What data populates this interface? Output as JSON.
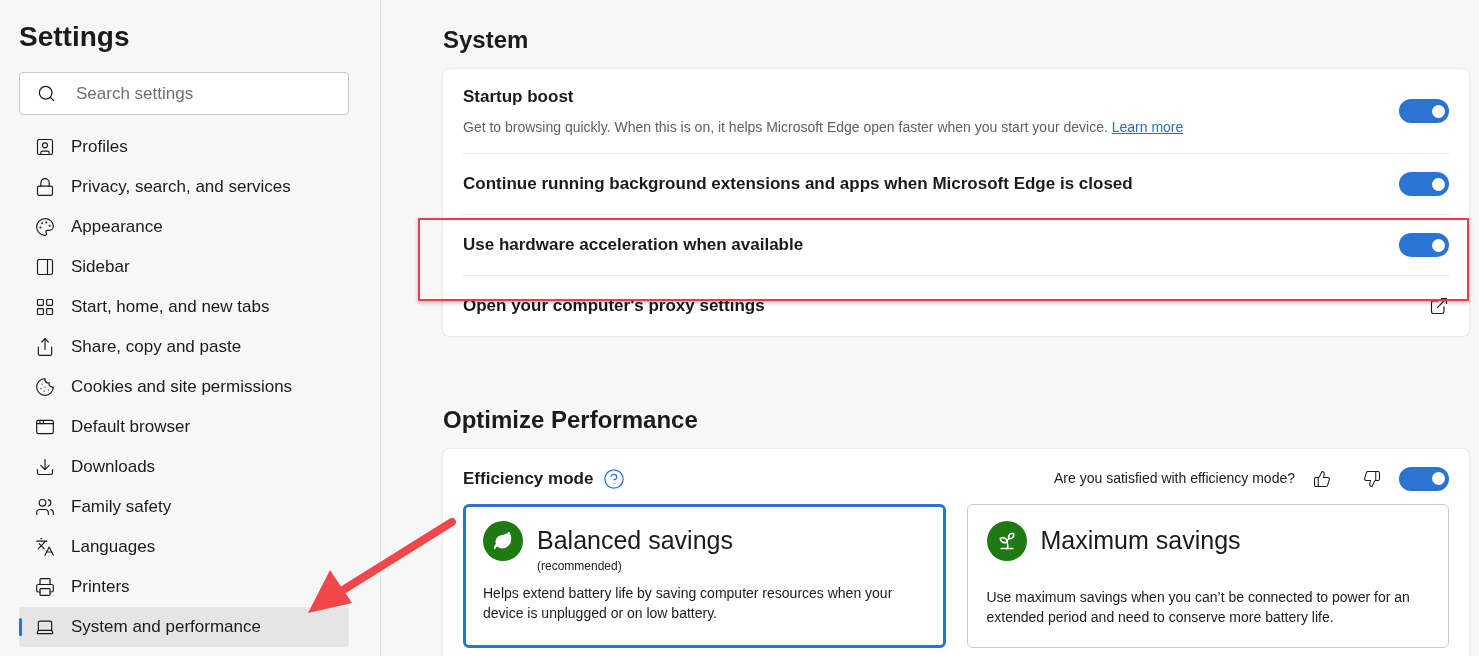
{
  "sidebar": {
    "title": "Settings",
    "search": {
      "placeholder": "Search settings"
    },
    "items": [
      {
        "label": "Profiles",
        "selected": false
      },
      {
        "label": "Privacy, search, and services",
        "selected": false
      },
      {
        "label": "Appearance",
        "selected": false
      },
      {
        "label": "Sidebar",
        "selected": false
      },
      {
        "label": "Start, home, and new tabs",
        "selected": false
      },
      {
        "label": "Share, copy and paste",
        "selected": false
      },
      {
        "label": "Cookies and site permissions",
        "selected": false
      },
      {
        "label": "Default browser",
        "selected": false
      },
      {
        "label": "Downloads",
        "selected": false
      },
      {
        "label": "Family safety",
        "selected": false
      },
      {
        "label": "Languages",
        "selected": false
      },
      {
        "label": "Printers",
        "selected": false
      },
      {
        "label": "System and performance",
        "selected": true
      }
    ]
  },
  "system": {
    "title": "System",
    "rows": [
      {
        "kind": "toggle",
        "label": "Startup boost",
        "description": "Get to browsing quickly. When this is on, it helps Microsoft Edge open faster when you start your device.",
        "link": "Learn more",
        "on": true
      },
      {
        "kind": "toggle",
        "label": "Continue running background extensions and apps when Microsoft Edge is closed",
        "on": true
      },
      {
        "kind": "toggle",
        "label": "Use hardware acceleration when available",
        "on": true
      },
      {
        "kind": "external",
        "label": "Open your computer's proxy settings"
      }
    ]
  },
  "performance": {
    "title": "Optimize Performance",
    "efficiency": {
      "label": "Efficiency mode",
      "feedback": "Are you satisfied with efficiency mode?",
      "on": true
    },
    "cards": [
      {
        "title": "Balanced savings",
        "subtitle": "(recommended)",
        "description": "Helps extend battery life by saving computer resources when your device is unplugged or on low battery.",
        "selected": true
      },
      {
        "title": "Maximum savings",
        "description": "Use maximum savings when you can’t be connected to power for an extended period and need to conserve more battery life.",
        "selected": false
      }
    ]
  }
}
